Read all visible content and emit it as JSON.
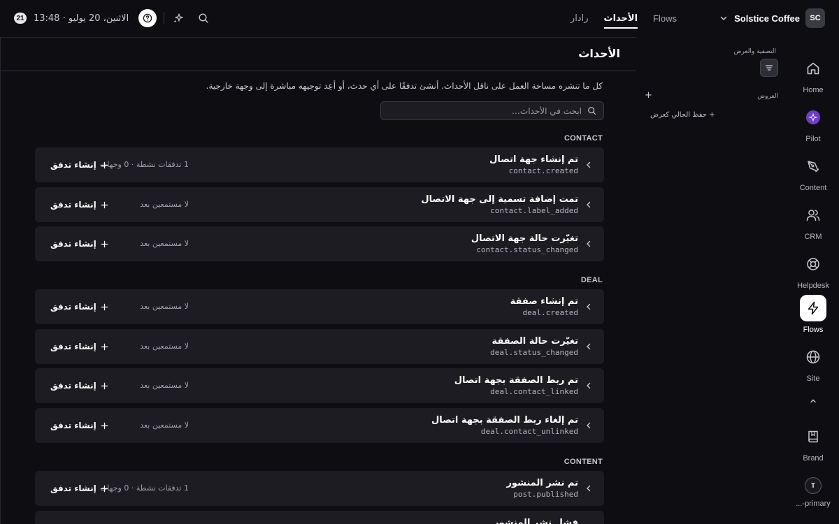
{
  "topbar": {
    "org_initials": "SC",
    "org_name": "Solstice Coffee",
    "tabs": [
      {
        "label": "Flows",
        "active": false
      },
      {
        "label": "الأحداث",
        "active": true
      },
      {
        "label": "رادار",
        "active": false
      }
    ],
    "date_badge": "21",
    "date_text": "الاثنين، 20 يوليو · 13:48"
  },
  "rail": {
    "items": [
      {
        "label": "Home",
        "icon": "home-icon",
        "active": false
      },
      {
        "label": "Pilot",
        "icon": "pilot-icon",
        "active": false
      },
      {
        "label": "Content",
        "icon": "pen-icon",
        "active": false
      },
      {
        "label": "CRM",
        "icon": "users-icon",
        "active": false
      },
      {
        "label": "Helpdesk",
        "icon": "lifebuoy-icon",
        "active": false
      },
      {
        "label": "Flows",
        "icon": "lightning-icon",
        "active": true
      },
      {
        "label": "Site",
        "icon": "globe-icon",
        "active": false
      },
      {
        "label": "Brand",
        "icon": "book-icon",
        "active": false
      }
    ],
    "user_initial": "T",
    "user_label": "...-primary"
  },
  "filter_panel": {
    "title": "التصفية والعرض",
    "views_label": "العروض",
    "add_label": "+",
    "save_view_label": "+ حفظ الحالي كعرض"
  },
  "main": {
    "title": "الأحداث",
    "description": "كل ما تنشره مساحة العمل على ناقل الأحداث. أنشئ تدفقًا على أي حدث، أو أعِد توجيهه مباشرة إلى وجهة خارجية.",
    "search_placeholder": "ابحث في الأحداث…",
    "create_flow_label": "إنشاء تدفق",
    "sections": [
      {
        "label": "CONTACT",
        "events": [
          {
            "title": "تم إنشاء جهة اتصال",
            "key": "contact.created",
            "status": "1 تدفقات نشطة · 0 وجهات"
          },
          {
            "title": "تمت إضافة تسمية إلى جهة الاتصال",
            "key": "contact.label_added",
            "status": "لا مستمعين بعد"
          },
          {
            "title": "تغيّرت حالة جهة الاتصال",
            "key": "contact.status_changed",
            "status": "لا مستمعين بعد"
          }
        ]
      },
      {
        "label": "DEAL",
        "events": [
          {
            "title": "تم إنشاء صفقة",
            "key": "deal.created",
            "status": "لا مستمعين بعد"
          },
          {
            "title": "تغيّرت حالة الصفقة",
            "key": "deal.status_changed",
            "status": "لا مستمعين بعد"
          },
          {
            "title": "تم ربط الصفقة بجهة اتصال",
            "key": "deal.contact_linked",
            "status": "لا مستمعين بعد"
          },
          {
            "title": "تم إلغاء ربط الصفقة بجهة اتصال",
            "key": "deal.contact_unlinked",
            "status": "لا مستمعين بعد"
          }
        ]
      },
      {
        "label": "CONTENT",
        "events": [
          {
            "title": "تم نشر المنشور",
            "key": "post.published",
            "status": "1 تدفقات نشطة · 0 وجهات"
          },
          {
            "title": "فشل نشر المنشور",
            "key": "",
            "status": ""
          }
        ]
      }
    ]
  }
}
